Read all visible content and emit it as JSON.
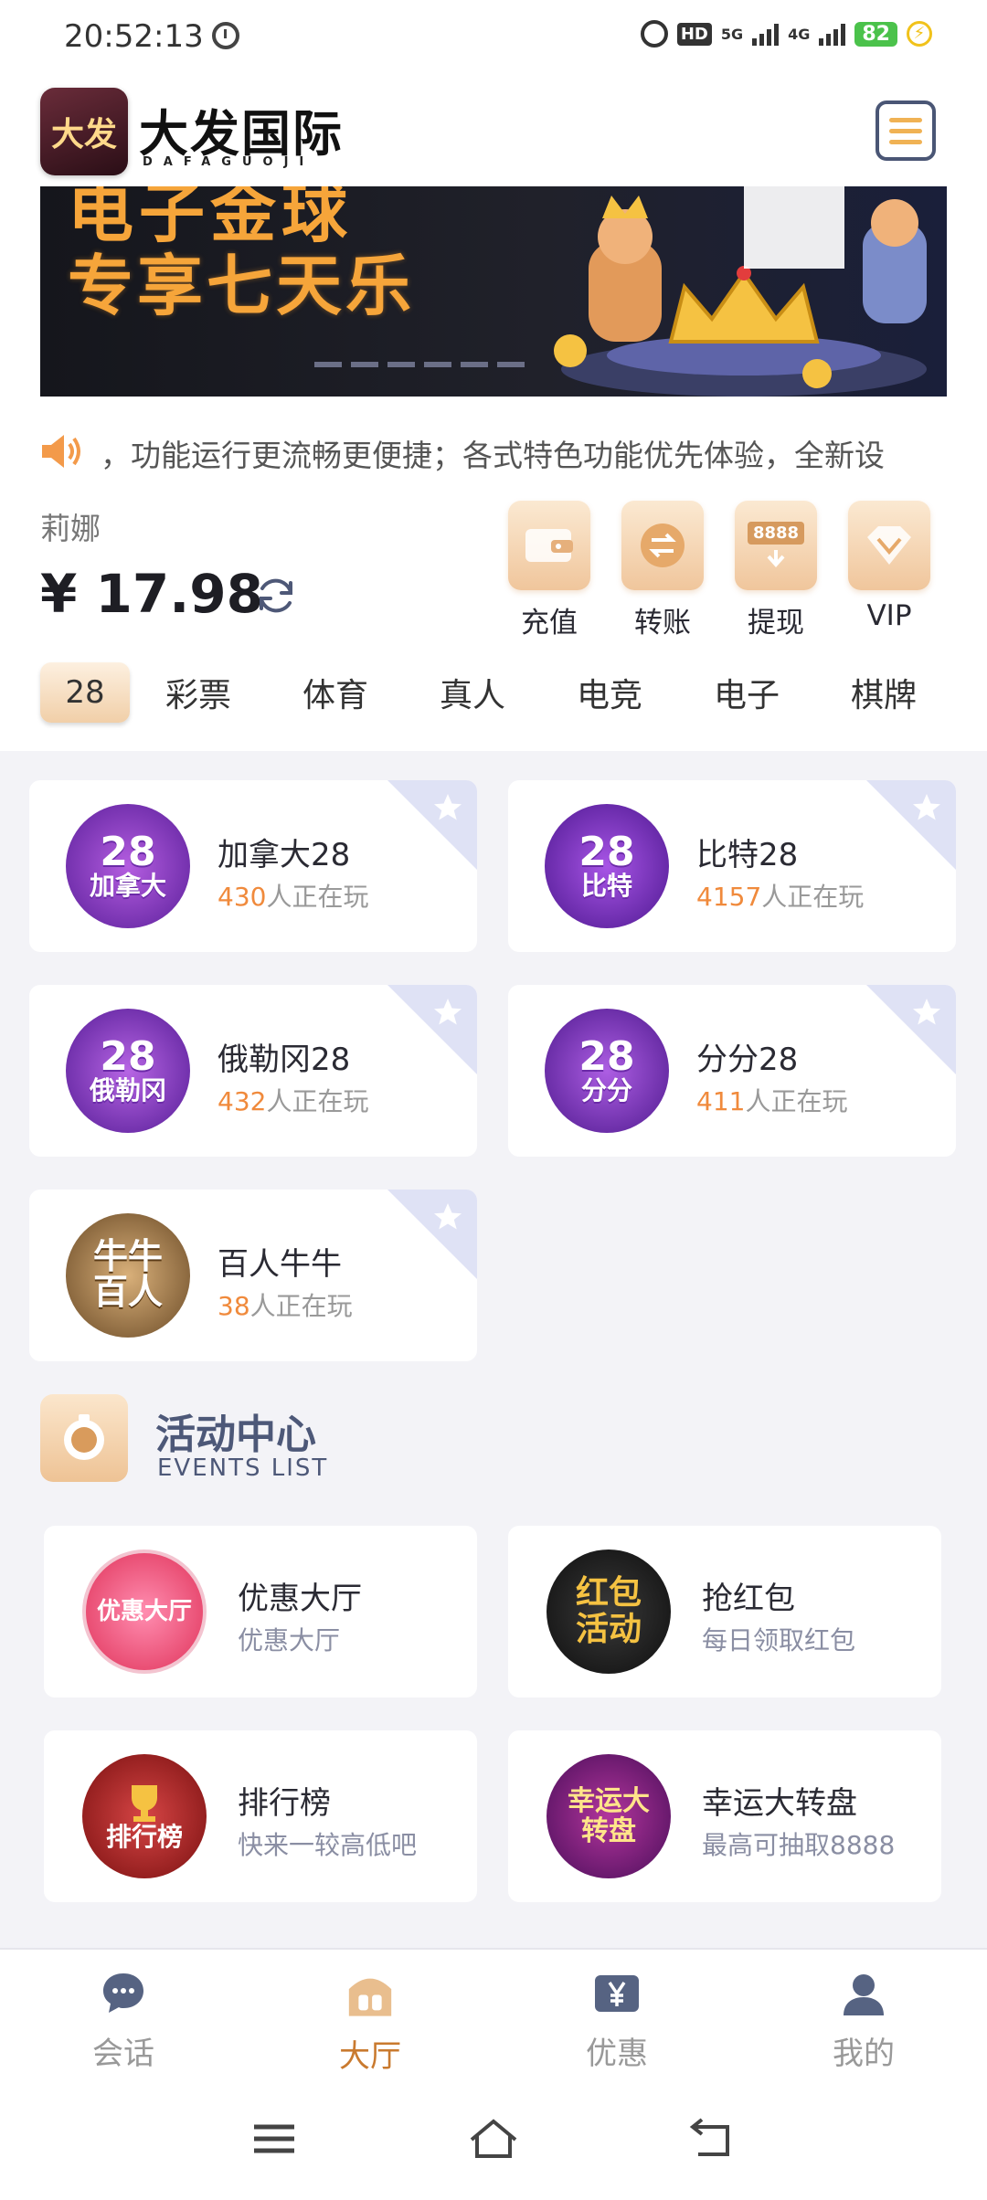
{
  "status_bar": {
    "time": "20:52:13",
    "network_5g": "5G",
    "network_4g": "4G",
    "hd": "HD",
    "battery": "82"
  },
  "header": {
    "logo_text": "大发",
    "title": "大发国际",
    "subtitle": "DAFAGUOJI"
  },
  "banner": {
    "line1": "电子金球",
    "line2": "专享七天乐"
  },
  "notice": {
    "text": "，功能运行更流畅更便捷；各式特色功能优先体验，全新设"
  },
  "account": {
    "username": "莉娜",
    "balance": "¥ 17.98"
  },
  "quick_actions": [
    {
      "label": "充值",
      "icon": "wallet-icon"
    },
    {
      "label": "转账",
      "icon": "transfer-icon"
    },
    {
      "label": "提现",
      "icon": "withdraw-icon"
    },
    {
      "label": "VIP",
      "icon": "vip-diamond-icon"
    }
  ],
  "categories": {
    "active": "28",
    "tabs": [
      "彩票",
      "体育",
      "真人",
      "电竞",
      "电子",
      "棋牌"
    ]
  },
  "games": [
    {
      "name": "加拿大28",
      "players": "430",
      "suffix": "人正在玩",
      "icon_big": "28",
      "icon_small": "加拿大"
    },
    {
      "name": "比特28",
      "players": "4157",
      "suffix": "人正在玩",
      "icon_big": "28",
      "icon_small": "比特"
    },
    {
      "name": "俄勒冈28",
      "players": "432",
      "suffix": "人正在玩",
      "icon_big": "28",
      "icon_small": "俄勒冈"
    },
    {
      "name": "分分28",
      "players": "411",
      "suffix": "人正在玩",
      "icon_big": "28",
      "icon_small": "分分"
    },
    {
      "name": "百人牛牛",
      "players": "38",
      "suffix": "人正在玩",
      "icon_big": "牛牛",
      "icon_small": "百人"
    }
  ],
  "events": {
    "title": "活动中心",
    "subtitle": "EVENTS LIST",
    "items": [
      {
        "name": "优惠大厅",
        "sub": "优惠大厅",
        "icon_text": "优惠大厅"
      },
      {
        "name": "抢红包",
        "sub": "每日领取红包",
        "icon_text": "红包活动"
      },
      {
        "name": "排行榜",
        "sub": "快来一较高低吧",
        "icon_text": "排行榜"
      },
      {
        "name": "幸运大转盘",
        "sub": "最高可抽取8888",
        "icon_text": "幸运大转盘"
      }
    ]
  },
  "bottom_nav": [
    {
      "label": "会话",
      "icon": "chat-icon",
      "active": false
    },
    {
      "label": "大厅",
      "icon": "lobby-icon",
      "active": true
    },
    {
      "label": "优惠",
      "icon": "yen-icon",
      "active": false
    },
    {
      "label": "我的",
      "icon": "user-icon",
      "active": false
    }
  ],
  "withdraw_icon_text": "8888"
}
